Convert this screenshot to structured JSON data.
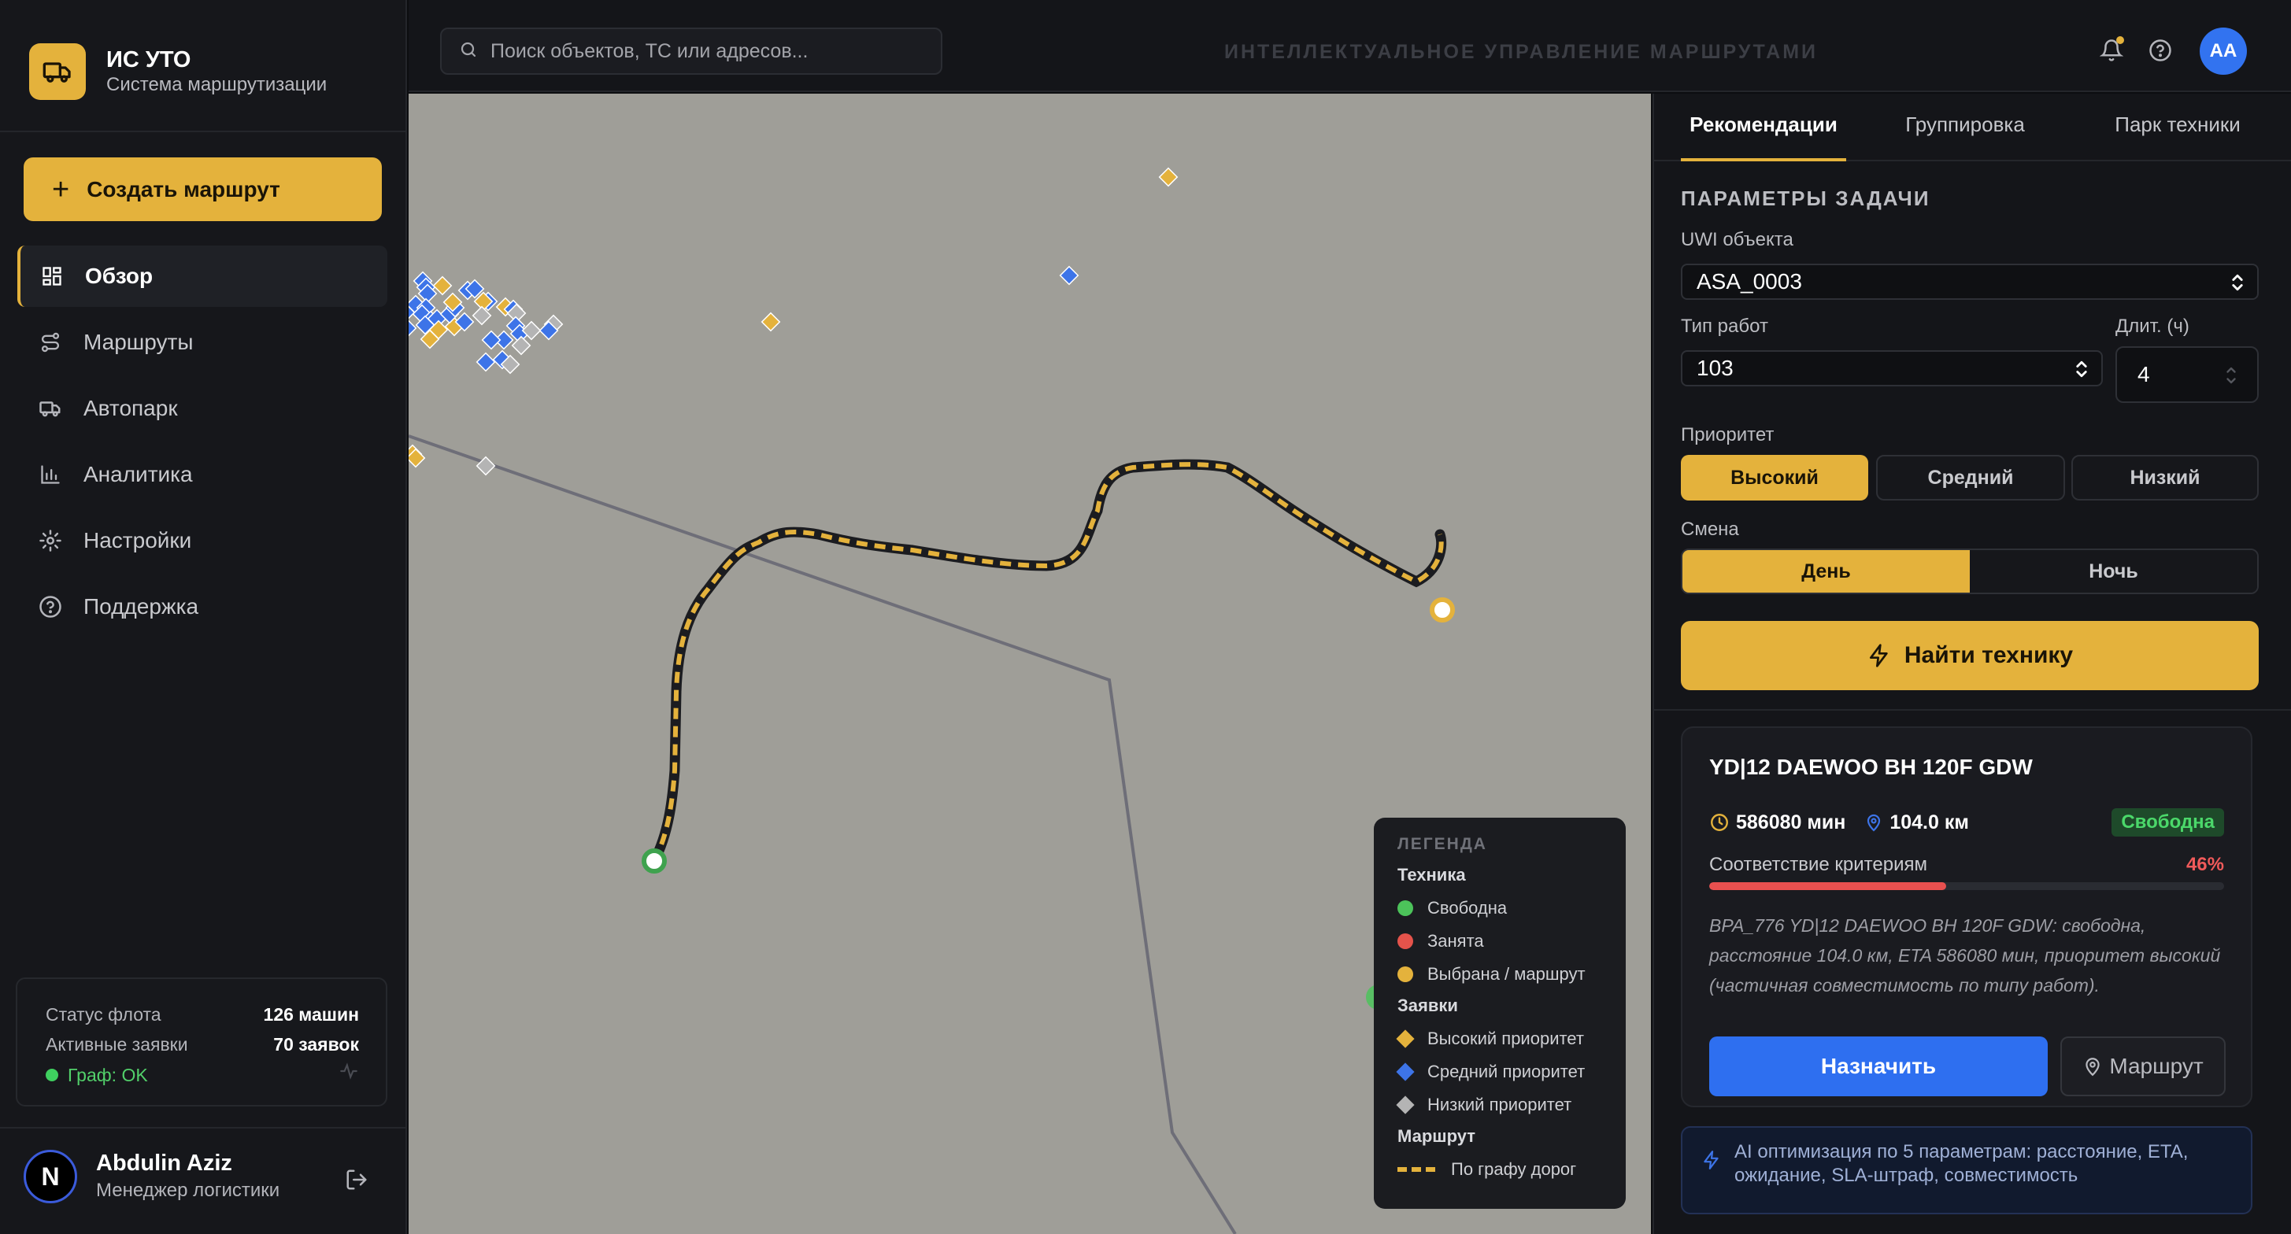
{
  "brand": {
    "title": "ИС УТО",
    "subtitle": "Система маршрутизации",
    "icon": "truck-icon"
  },
  "create_button": "Создать маршрут",
  "nav": [
    {
      "label": "Обзор",
      "icon": "grid-icon",
      "active": true
    },
    {
      "label": "Маршруты",
      "icon": "route-icon",
      "active": false
    },
    {
      "label": "Автопарк",
      "icon": "truck-icon",
      "active": false
    },
    {
      "label": "Аналитика",
      "icon": "chart-icon",
      "active": false
    },
    {
      "label": "Настройки",
      "icon": "gear-icon",
      "active": false
    },
    {
      "label": "Поддержка",
      "icon": "help-icon",
      "active": false
    }
  ],
  "fleet": {
    "status_label": "Статус флота",
    "status_value": "126 машин",
    "requests_label": "Активные заявки",
    "requests_value": "70 заявок",
    "graph_status": "Граф: OK"
  },
  "user": {
    "initial": "N",
    "name": "Abdulin Aziz",
    "role": "Менеджер логистики"
  },
  "topbar": {
    "search_placeholder": "Поиск объектов, ТС или адресов...",
    "title": "ИНТЕЛЛЕКТУАЛЬНОЕ УПРАВЛЕНИЕ МАРШРУТАМИ",
    "avatar": "AA"
  },
  "legend": {
    "title": "ЛЕГЕНДА",
    "vehicles_title": "Техника",
    "vehicles": [
      {
        "label": "Свободна",
        "color": "#4cc35a"
      },
      {
        "label": "Занята",
        "color": "#e5534b"
      },
      {
        "label": "Выбрана / маршрут",
        "color": "#e4b23c"
      }
    ],
    "requests_title": "Заявки",
    "requests": [
      {
        "label": "Высокий приоритет",
        "color": "#e4b23c"
      },
      {
        "label": "Средний приоритет",
        "color": "#3d74e8"
      },
      {
        "label": "Низкий приоритет",
        "color": "#b4b4b4"
      }
    ],
    "route_title": "Маршрут",
    "route": "По графу дорог"
  },
  "panel": {
    "tabs": [
      "Рекомендации",
      "Группировка",
      "Парк техники"
    ],
    "section_title": "ПАРАМЕТРЫ ЗАДАЧИ",
    "uwi_label": "UWI объекта",
    "uwi_value": "ASA_0003",
    "work_type_label": "Тип работ",
    "work_type_value": "103",
    "duration_label": "Длит. (ч)",
    "duration_value": "4",
    "priority_label": "Приоритет",
    "priority_options": [
      "Высокий",
      "Средний",
      "Низкий"
    ],
    "shift_label": "Смена",
    "shift_options": [
      "День",
      "Ночь"
    ],
    "find_button": "Найти технику"
  },
  "vehicle_card": {
    "title": "YD|12 DAEWOO BH 120F GDW",
    "eta": "586080 мин",
    "distance": "104.0 км",
    "status": "Свободна",
    "match_label": "Соответствие критериям",
    "match_value": "46%",
    "match_fraction": 0.46,
    "description": "BPA_776 YD|12 DAEWOO BH 120F GDW: свободна, расстояние 104.0 км, ETA 586080 мин, приоритет высокий (частичная совместимость по типу работ).",
    "assign_button": "Назначить",
    "route_button": "Маршрут"
  },
  "ai_note": "AI оптимизация по 5 параметрам: расстояние, ETA, ожидание, SLA-штраф, совместимость"
}
